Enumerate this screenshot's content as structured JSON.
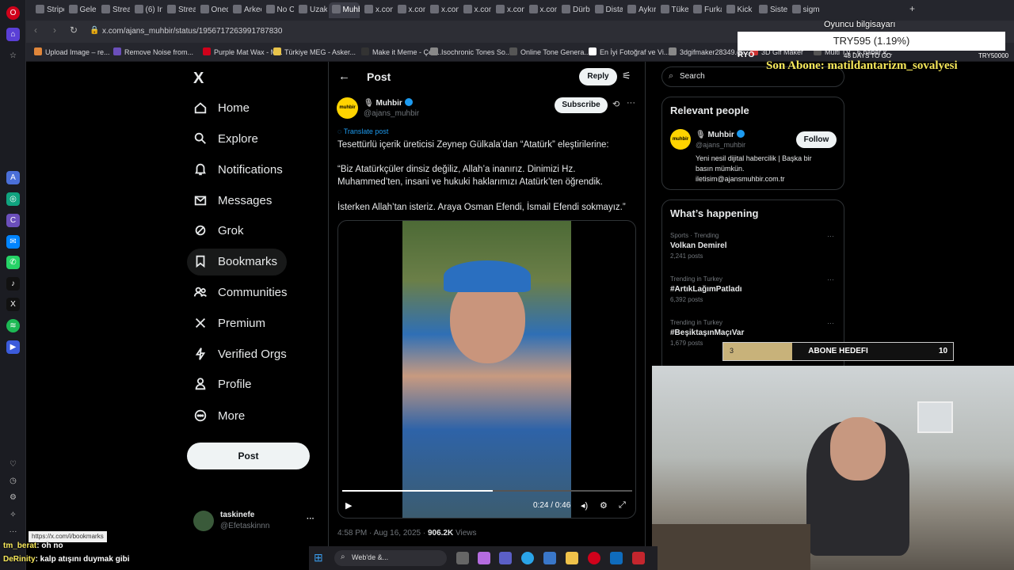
{
  "browser": {
    "tabs": [
      "Stripe",
      "Gelen",
      "Stream",
      "(6) Ins",
      "Stream",
      "Onedi",
      "Arkeo",
      "No Co",
      "Uzakt",
      "Muhbir",
      "x.com",
      "x.com",
      "x.com",
      "x.com",
      "x.com",
      "x.com",
      "Dürbü",
      "Distas",
      "Aykırı",
      "Tüketi",
      "Furka",
      "Kick",
      "Sister",
      "sigmu"
    ],
    "active_tab_index": 9,
    "url": "x.com/ajans_muhbir/status/1956717263991787830",
    "bookmarks": [
      "Upload Image – re...",
      "Remove Noise from...",
      "Purple Mat Wax - M...",
      "Türkiye MEG - Asker...",
      "Make it Meme - Çev...",
      "Isochronic Tones So...",
      "Online Tone Genera...",
      "En İyi Fotoğraf ve Vi...",
      "3dgifmaker28349.gi...",
      "3D Gif Maker",
      "Multi TV - 6 haber k..."
    ],
    "status_url": "https://x.com/i/bookmarks"
  },
  "nav": {
    "logo": "X",
    "items": [
      "Home",
      "Explore",
      "Notifications",
      "Messages",
      "Grok",
      "Bookmarks",
      "Communities",
      "Premium",
      "Verified Orgs",
      "Profile",
      "More"
    ],
    "post_button": "Post",
    "user_name": "taskinefe",
    "user_handle": "@Efetaskinnn",
    "more_dots": "···"
  },
  "post": {
    "header_title": "Post",
    "reply_label": "Reply",
    "author_name": "Muhbir",
    "author_handle": "@ajans_muhbir",
    "avatar_text": "muhbir",
    "subscribe_label": "Subscribe",
    "translate_label": "Translate post",
    "text1": "Tesettürlü içerik üreticisi Zeynep Gülkala’dan “Atatürk” eleştirilerine:",
    "text2": "“Biz Atatürkçüler dinsiz değiliz, Allah’a inanırız. Dinimizi Hz. Muhammed’ten, insani ve hukuki haklarımızı Atatürk’ten öğrendik.",
    "text3": "İsterken Allah’tan isteriz. Araya Osman Efendi, İsmail Efendi sokmayız.”",
    "video_time": "0:24 / 0:46",
    "video_progress": 0.52,
    "timestamp": "4:58 PM · Aug 16, 2025 · ",
    "views_count": "906.2K",
    "views_label": " Views"
  },
  "right": {
    "search_placeholder": "Search",
    "relevant_title": "Relevant people",
    "rp_name": "Muhbir",
    "rp_handle": "@ajans_muhbir",
    "rp_follow": "Follow",
    "rp_bio1": "Yeni nesil dijital habercilik | Başka bir",
    "rp_bio2": "basın mümkün.",
    "rp_bio3": "iletisim@ajansmuhbir.com.tr",
    "happening_title": "What’s happening",
    "trends": [
      {
        "meta": "Sports · Trending",
        "name": "Volkan Demirel",
        "posts": "2,241 posts"
      },
      {
        "meta": "Trending in Turkey",
        "name": "#ArtıkLağımPatladı",
        "posts": "6,392 posts"
      },
      {
        "meta": "Trending in Turkey",
        "name": "#BeşiktaşınMaçıVar",
        "posts": "1,679 posts"
      }
    ]
  },
  "overlay": {
    "oyuncu": "Oyuncu bilgisayarı",
    "try_amount": "TRY595 (1.19%)",
    "ryo": "RYO",
    "days_to_go": "48 DAYS TO GO",
    "try_target": "TRY50000",
    "son_abone": "Son Abone: matildantarizm_sovalyesi",
    "goal_current": "3",
    "goal_label": "ABONE HEDEFI",
    "goal_target": "10",
    "goal_fraction": 0.3
  },
  "chat": [
    {
      "user": "tm_berat",
      "msg": ": oh no"
    },
    {
      "user": "DeRinity",
      "msg": ": kalp atışını duymak gibi"
    }
  ],
  "taskbar": {
    "search_label": "Web'de &..."
  }
}
